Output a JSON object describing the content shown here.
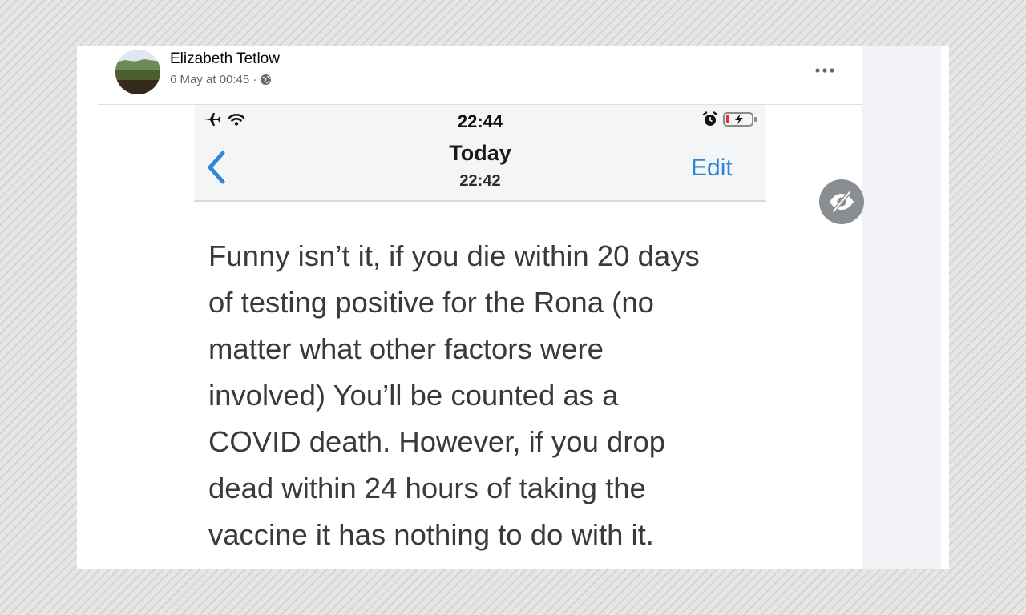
{
  "post": {
    "author_name": "Elizabeth Tetlow",
    "timestamp": "6 May at 00:45 ·",
    "audience_icon": "globe-icon",
    "more_icon": "more-options-icon"
  },
  "screenshot": {
    "status_bar": {
      "time": "22:44",
      "left_icons": [
        "airplane-icon",
        "wifi-icon"
      ],
      "right_icons": [
        "alarm-icon",
        "battery-low-icon"
      ]
    },
    "nav": {
      "back_icon": "chevron-left-icon",
      "title": "Today",
      "subtitle": "22:42",
      "edit_label": "Edit"
    },
    "note_text": "Funny isn’t it, if you die within 20 days\nof testing positive for the Rona (no\nmatter what other factors were\ninvolved) You’ll be counted as a\nCOVID death. However, if you drop\ndead within 24 hours of taking the\nvaccine it has nothing to do with it."
  },
  "overlay": {
    "visibility_icon": "eye-slash-icon"
  },
  "colors": {
    "accent_blue": "#2f86d6",
    "meta_gray": "#65676b",
    "panel_gray": "#f0f2f5"
  }
}
